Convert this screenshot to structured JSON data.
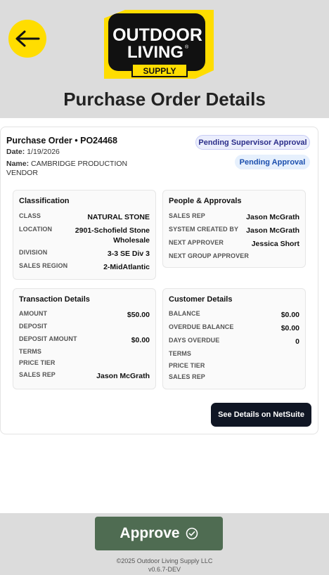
{
  "header": {
    "title": "Purchase Order Details",
    "logo": {
      "line1": "OUTDOOR",
      "line2": "LIVING",
      "line3": "SUPPLY",
      "mark": "®"
    },
    "back_icon": "arrow-left-icon"
  },
  "po": {
    "title": "Purchase Order • PO24468",
    "date_label": "Date:",
    "date_value": "1/19/2026",
    "name_label": "Name:",
    "name_value": "CAMBRIDGE PRODUCTION VENDOR",
    "badges": [
      "Pending Supervisor Approval",
      "Pending Approval"
    ]
  },
  "classification": {
    "title": "Classification",
    "rows": [
      {
        "label": "CLASS",
        "value": "NATURAL STONE"
      },
      {
        "label": "LOCATION",
        "value": "2901-Schofield Stone Wholesale"
      },
      {
        "label": "DIVISION",
        "value": "3-3 SE Div 3"
      },
      {
        "label": "SALES REGION",
        "value": "2-MidAtlantic"
      }
    ]
  },
  "people": {
    "title": "People & Approvals",
    "rows": [
      {
        "label": "SALES REP",
        "value": "Jason McGrath"
      },
      {
        "label": "SYSTEM CREATED BY",
        "value": "Jason McGrath"
      },
      {
        "label": "NEXT APPROVER",
        "value": "Jessica Short"
      },
      {
        "label": "NEXT GROUP APPROVER",
        "value": ""
      }
    ]
  },
  "transaction": {
    "title": "Transaction Details",
    "rows": [
      {
        "label": "AMOUNT",
        "value": "$50.00"
      },
      {
        "label": "DEPOSIT",
        "value": ""
      },
      {
        "label": "DEPOSIT AMOUNT",
        "value": "$0.00"
      },
      {
        "label": "TERMS",
        "value": ""
      },
      {
        "label": "PRICE TIER",
        "value": ""
      },
      {
        "label": "SALES REP",
        "value": "Jason McGrath"
      }
    ]
  },
  "customer": {
    "title": "Customer Details",
    "rows": [
      {
        "label": "BALANCE",
        "value": "$0.00"
      },
      {
        "label": "OVERDUE BALANCE",
        "value": "$0.00"
      },
      {
        "label": "DAYS OVERDUE",
        "value": "0"
      },
      {
        "label": "TERMS",
        "value": ""
      },
      {
        "label": "PRICE TIER",
        "value": ""
      },
      {
        "label": "SALES REP",
        "value": ""
      }
    ]
  },
  "actions": {
    "netsuite_label": "See Details on NetSuite",
    "approve_label": "Approve",
    "approve_icon": "check-circle-icon"
  },
  "footer": {
    "copyright": "©2025 Outdoor Living Supply LLC",
    "version": "v0.6.7-DEV"
  },
  "colors": {
    "accent_yellow": "#ffdd00",
    "approve_green": "#4f6c52",
    "netsuite_dark": "#101624",
    "badge_supervisor_text": "#2b2e8a",
    "badge_pending_text": "#1c4fae"
  }
}
